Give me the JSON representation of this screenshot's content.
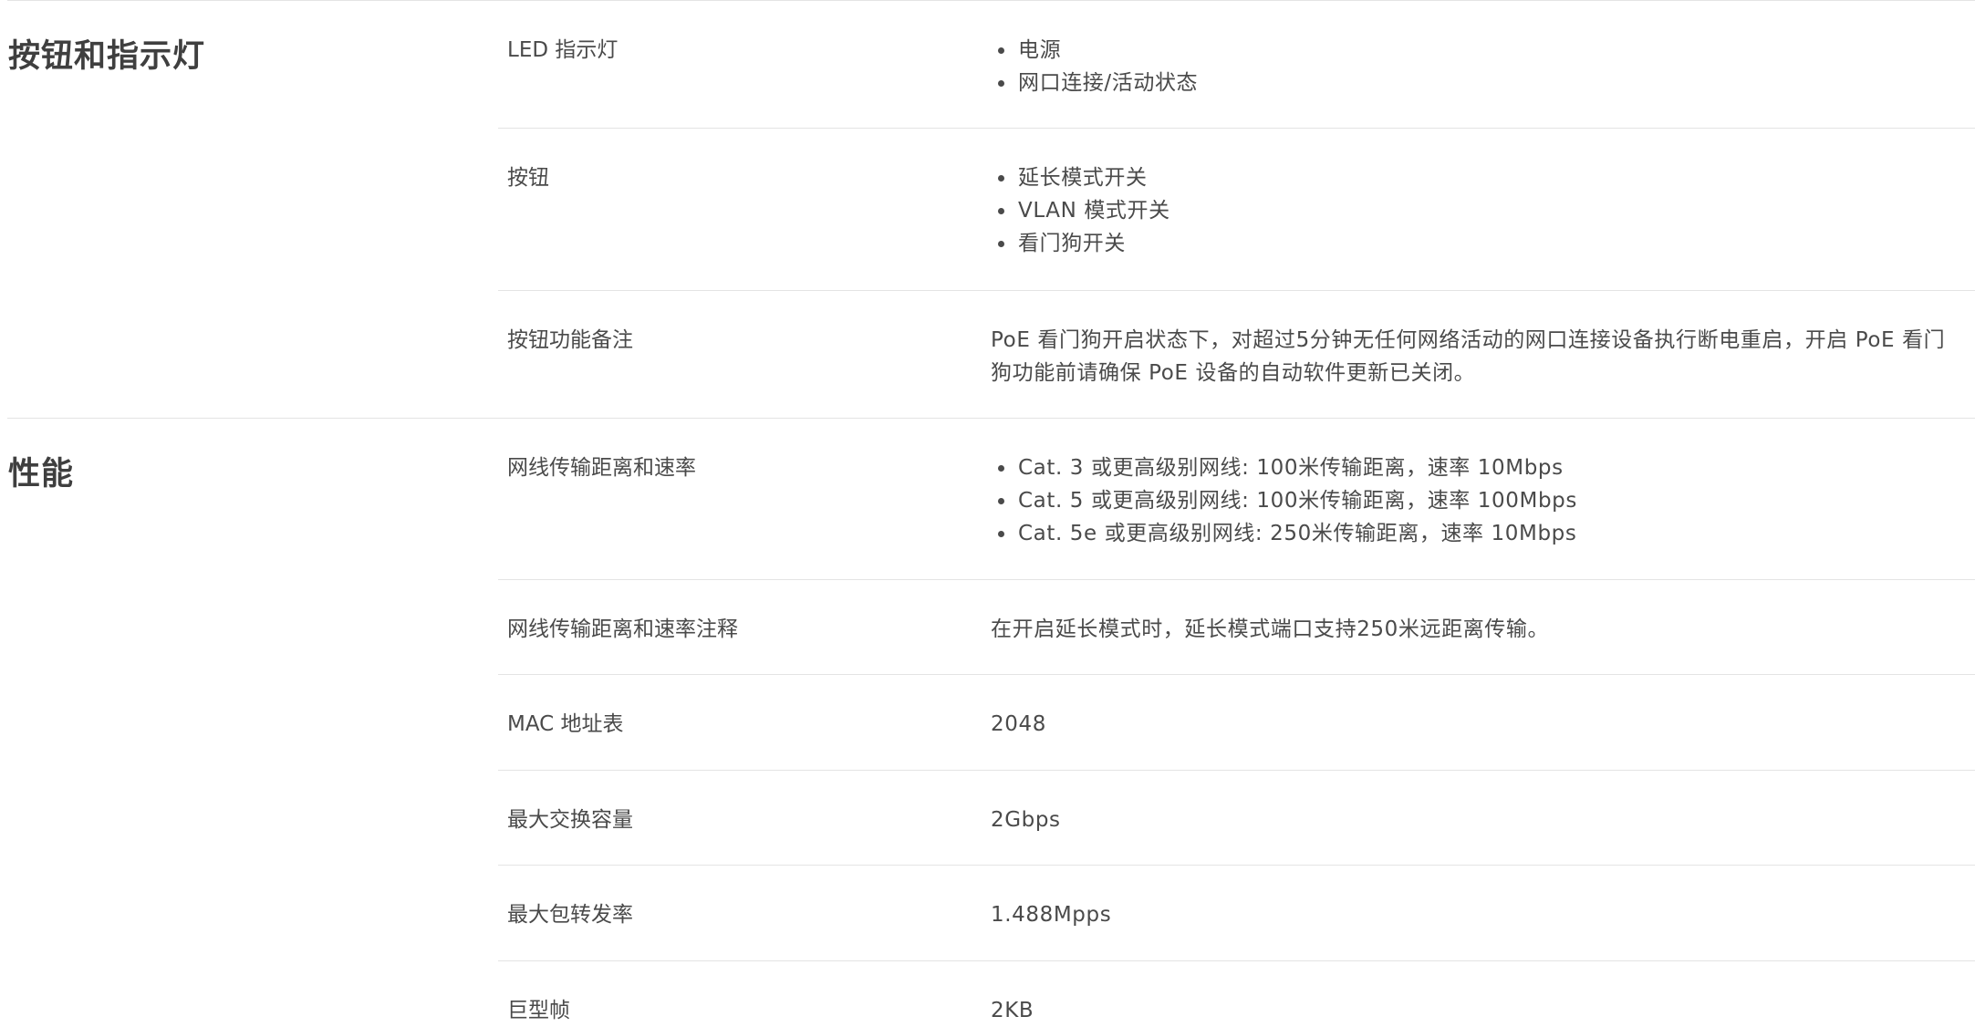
{
  "sections": [
    {
      "title": "按钮和指示灯",
      "rows": [
        {
          "label": "LED 指示灯",
          "bullets": [
            "电源",
            "网口连接/活动状态"
          ]
        },
        {
          "label": "按钮",
          "bullets": [
            "延长模式开关",
            "VLAN 模式开关",
            "看门狗开关"
          ]
        },
        {
          "label": "按钮功能备注",
          "text": "PoE 看门狗开启状态下，对超过5分钟无任何网络活动的网口连接设备执行断电重启，开启 PoE 看门狗功能前请确保 PoE 设备的自动软件更新已关闭。"
        }
      ]
    },
    {
      "title": "性能",
      "rows": [
        {
          "label": "网线传输距离和速率",
          "bullets": [
            "Cat. 3 或更高级别网线: 100米传输距离，速率 10Mbps",
            "Cat. 5 或更高级别网线: 100米传输距离，速率 100Mbps",
            "Cat. 5e 或更高级别网线: 250米传输距离，速率 10Mbps"
          ]
        },
        {
          "label": "网线传输距离和速率注释",
          "text": "在开启延长模式时，延长模式端口支持250米远距离传输。"
        },
        {
          "label": "MAC 地址表",
          "text": "2048"
        },
        {
          "label": "最大交换容量",
          "text": "2Gbps"
        },
        {
          "label": "最大包转发率",
          "text": "1.488Mpps"
        },
        {
          "label": "巨型帧",
          "text": "2KB"
        }
      ]
    }
  ]
}
